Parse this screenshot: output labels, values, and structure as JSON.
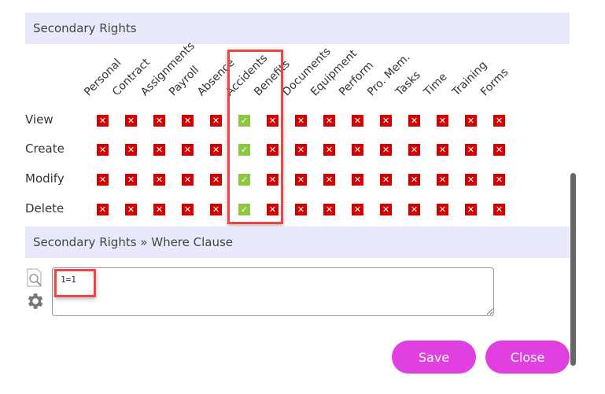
{
  "section1": {
    "title": "Secondary Rights"
  },
  "columns": [
    "Personal",
    "Contract",
    "Assignments",
    "Payroll",
    "Absence",
    "Accidents",
    "Benefits",
    "Documents",
    "Equipment",
    "Perform",
    "Pro. Mem.",
    "Tasks",
    "Time",
    "Training",
    "Forms"
  ],
  "rows": [
    {
      "label": "View",
      "values": [
        0,
        0,
        0,
        0,
        0,
        1,
        0,
        0,
        0,
        0,
        0,
        0,
        0,
        0,
        0
      ]
    },
    {
      "label": "Create",
      "values": [
        0,
        0,
        0,
        0,
        0,
        1,
        0,
        0,
        0,
        0,
        0,
        0,
        0,
        0,
        0
      ]
    },
    {
      "label": "Modify",
      "values": [
        0,
        0,
        0,
        0,
        0,
        1,
        0,
        0,
        0,
        0,
        0,
        0,
        0,
        0,
        0
      ]
    },
    {
      "label": "Delete",
      "values": [
        0,
        0,
        0,
        0,
        0,
        1,
        0,
        0,
        0,
        0,
        0,
        0,
        0,
        0,
        0
      ]
    }
  ],
  "icons": {
    "granted": "check-icon",
    "denied": "cross-icon"
  },
  "colors": {
    "granted": "#8dc63f",
    "denied": "#d40000",
    "button": "#e040e0",
    "highlight": "#f04545"
  },
  "section2": {
    "title": "Secondary Rights » Where Clause",
    "where_value": "1=1"
  },
  "buttons": {
    "save": "Save",
    "close": "Close"
  }
}
